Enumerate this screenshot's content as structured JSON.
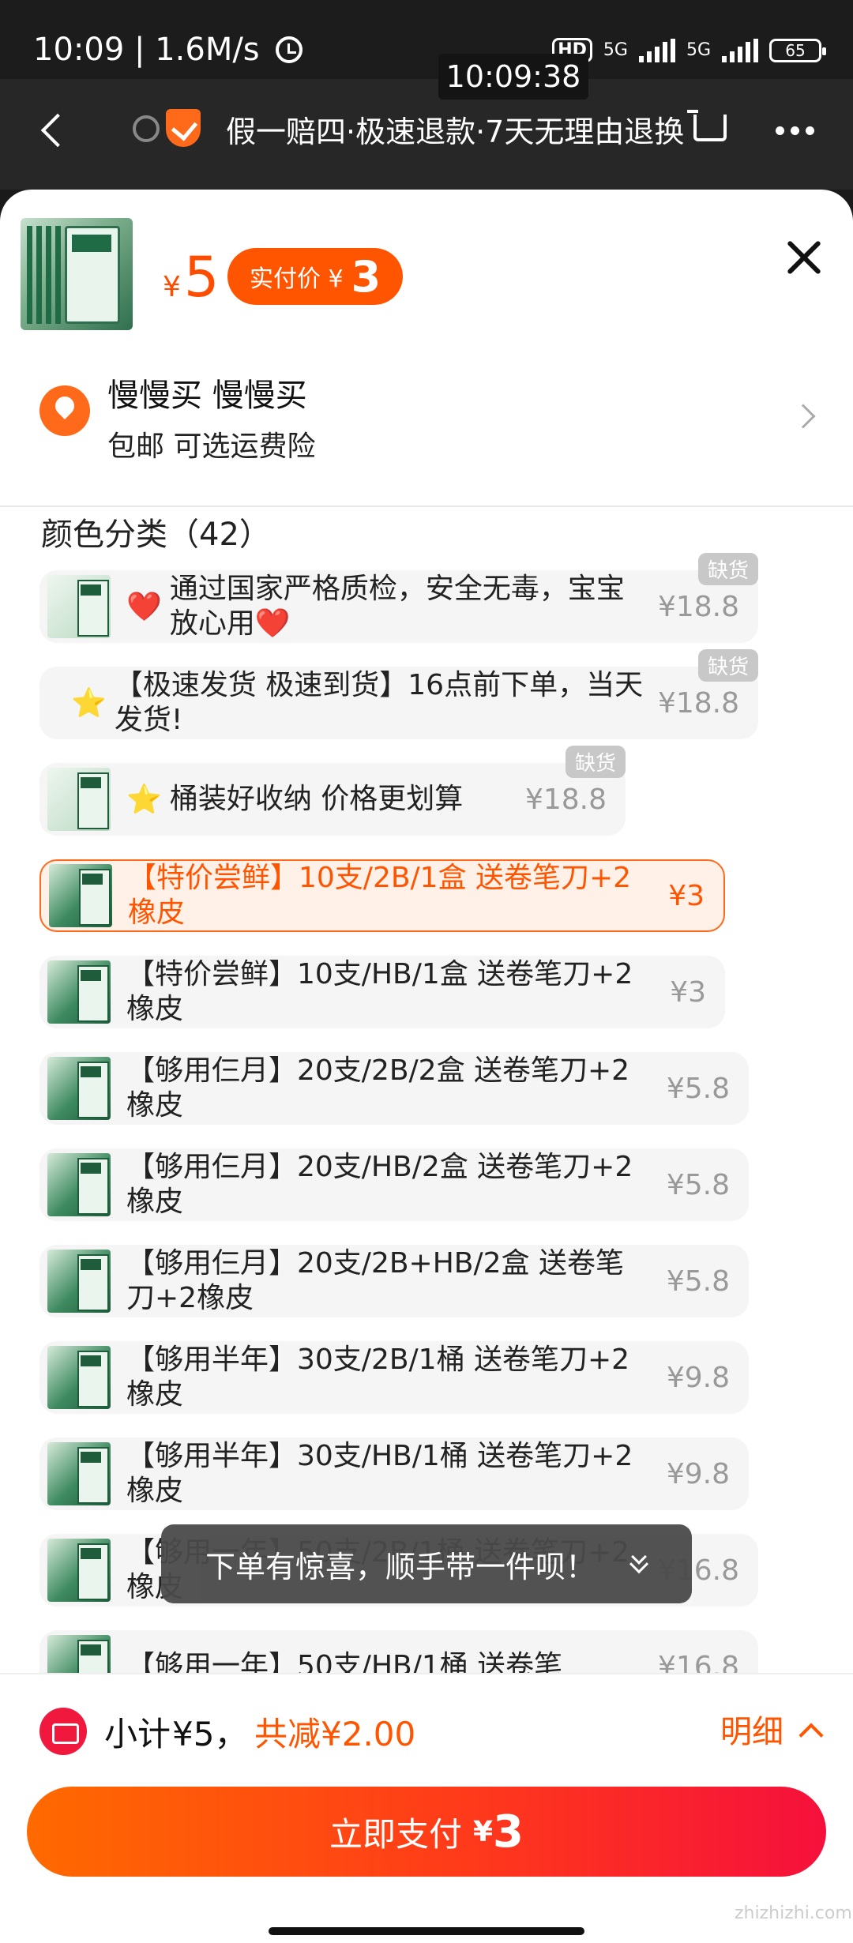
{
  "status_bar": {
    "time": "10:09",
    "speed": "1.6M/s",
    "hd": "HD",
    "net1": "5G",
    "net2": "5G",
    "battery": "65",
    "overlay_time": "10:09:38"
  },
  "nav": {
    "guarantee_text": "假一赔四·极速退款·7天无理由退换"
  },
  "product": {
    "price_symbol": "¥",
    "price": "5",
    "paid_label": "实付价 ¥",
    "paid_value": "3"
  },
  "address": {
    "name": "慢慢买 慢慢买",
    "shipping": "包邮 可选运费险"
  },
  "section": {
    "title": "颜色分类（42）"
  },
  "options": [
    {
      "emoji": "❤️",
      "emoji_type": "heart",
      "label": "通过国家严格质检，安全无毒，宝宝放心用❤️",
      "price": "¥18.8",
      "tag": "缺货",
      "thumb": true
    },
    {
      "emoji": "⭐",
      "emoji_type": "star",
      "label": "【极速发货 极速到货】16点前下单，当天发货!",
      "price": "¥18.8",
      "tag": "缺货",
      "thumb": false
    },
    {
      "emoji": "⭐",
      "emoji_type": "star",
      "label": "桶装好收纳 价格更划算",
      "price": "¥18.8",
      "tag": "缺货",
      "thumb": true
    },
    {
      "label": "【特价尝鲜】10支/2B/1盒 送卷笔刀+2橡皮",
      "price": "¥3",
      "selected": true,
      "thumb": true
    },
    {
      "label": "【特价尝鲜】10支/HB/1盒 送卷笔刀+2橡皮",
      "price": "¥3",
      "thumb": true
    },
    {
      "label": "【够用仨月】20支/2B/2盒 送卷笔刀+2橡皮",
      "price": "¥5.8",
      "thumb": true
    },
    {
      "label": "【够用仨月】20支/HB/2盒 送卷笔刀+2橡皮",
      "price": "¥5.8",
      "thumb": true
    },
    {
      "label": "【够用仨月】20支/2B+HB/2盒 送卷笔刀+2橡皮",
      "price": "¥5.8",
      "thumb": true
    },
    {
      "label": "【够用半年】30支/2B/1桶 送卷笔刀+2橡皮",
      "price": "¥9.8",
      "thumb": true
    },
    {
      "label": "【够用半年】30支/HB/1桶 送卷笔刀+2橡皮",
      "price": "¥9.8",
      "thumb": true
    },
    {
      "label": "【够用一年】50支/2B/1桶 送卷笔刀+2橡皮",
      "price": "¥16.8",
      "thumb": true
    },
    {
      "label": "【够用一年】50支/HB/1桶 送卷笔",
      "price": "¥16.8",
      "thumb": true
    }
  ],
  "toast": {
    "text": "下单有惊喜，顺手带一件呗！"
  },
  "footer": {
    "subtotal_label": "小计",
    "subtotal_value": "¥5，",
    "saved_text": "共减¥2.00",
    "detail_label": "明细",
    "pay_label": "立即支付",
    "pay_symbol": "¥",
    "pay_value": "3",
    "watermark": "zhizhizhi.com"
  },
  "colors": {
    "accent": "#ff5500",
    "selected_bg": "#fff0e8",
    "item_bg": "#f5f5f5",
    "oos_tag": "#c8c8c8"
  }
}
